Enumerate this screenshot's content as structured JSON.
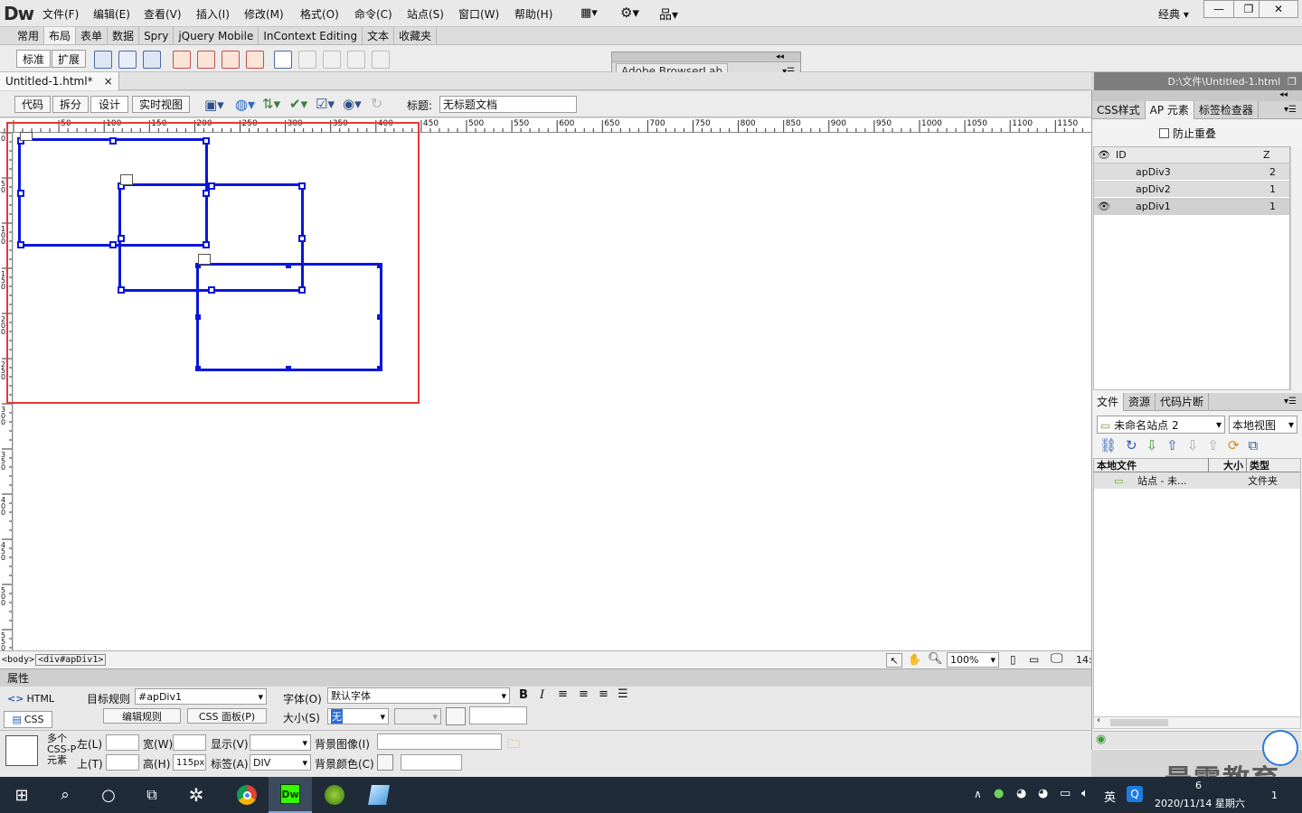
{
  "app": {
    "logo": "Dw",
    "workspace": "经典",
    "win_min": "—",
    "win_max": "❐",
    "win_close": "✕"
  },
  "menu": [
    "文件(F)",
    "编辑(E)",
    "查看(V)",
    "插入(I)",
    "修改(M)",
    "格式(O)",
    "命令(C)",
    "站点(S)",
    "窗口(W)",
    "帮助(H)"
  ],
  "insert_tabs": [
    "常用",
    "布局",
    "表单",
    "数据",
    "Spry",
    "jQuery Mobile",
    "InContext Editing",
    "文本",
    "收藏夹"
  ],
  "insert_active": "布局",
  "layout_modes": [
    "标准",
    "扩展"
  ],
  "browserlab": {
    "title": "Adobe BrowserLab"
  },
  "document": {
    "tab": "Untitled-1.html*",
    "close": "×",
    "path": "D:\\文件\\Untitled-1.html"
  },
  "doc_toolbar": {
    "views": [
      "代码",
      "拆分",
      "设计",
      "实时视图"
    ],
    "title_label": "标题:",
    "title_value": "无标题文档"
  },
  "ruler": {
    "h_ticks": [
      "50",
      "100",
      "150",
      "200",
      "250",
      "300",
      "350",
      "400",
      "450",
      "500",
      "550",
      "600",
      "650",
      "700",
      "750",
      "800",
      "850",
      "900",
      "950",
      "1000",
      "1050",
      "1100",
      "1150"
    ],
    "v_ticks": [
      "0",
      "5 0",
      "1 0 0",
      "1 5 0",
      "2 0 0",
      "2 5 0",
      "3 0 0",
      "3 5 0",
      "4 0 0",
      "4 5 0",
      "5 0 0",
      "5 5 0"
    ]
  },
  "tag_selector": [
    "<body>",
    "<div#apDiv1>"
  ],
  "status": {
    "zoom": "100%",
    "size": "14:"
  },
  "properties": {
    "header": "属性",
    "html_btn": "HTML",
    "css_btn": "CSS",
    "target_rule_label": "目标规则",
    "target_rule_value": "#apDiv1",
    "edit_rule": "编辑规则",
    "css_panel": "CSS 面板(P)",
    "font_label": "字体(O)",
    "font_value": "默认字体",
    "size_label": "大小(S)",
    "size_value": "无",
    "bold": "B",
    "italic": "I",
    "multi_label": [
      "多个",
      "CSS-P",
      "元素"
    ],
    "left_label": "左(L)",
    "top_label": "上(T)",
    "width_label": "宽(W)",
    "height_label": "高(H)",
    "height_value": "115px",
    "vis_label": "显示(V)",
    "tag_label": "标签(A)",
    "tag_value": "DIV",
    "bg_image_label": "背景图像(I)",
    "bg_color_label": "背景颜色(C)"
  },
  "ap_panel": {
    "tabs": [
      "CSS样式",
      "AP 元素",
      "标签检查器"
    ],
    "active": "AP 元素",
    "prevent_overlap": "防止重叠",
    "columns": {
      "id": "ID",
      "z": "Z"
    },
    "rows": [
      {
        "id": "apDiv3",
        "z": "2",
        "eye": false
      },
      {
        "id": "apDiv2",
        "z": "1",
        "eye": false
      },
      {
        "id": "apDiv1",
        "z": "1",
        "eye": true
      }
    ]
  },
  "files_panel": {
    "tabs": [
      "文件",
      "资源",
      "代码片断"
    ],
    "site": "未命名站点 2",
    "view": "本地视图",
    "columns": [
      "本地文件",
      "大小",
      "类型"
    ],
    "rows": [
      {
        "name": "站点 - 未...",
        "type": "文件夹"
      }
    ]
  },
  "taskbar": {
    "ime": "英",
    "time": "6",
    "date": "2020/11/14 星期六",
    "notif": "1"
  },
  "watermark": "最需教育",
  "colors": {
    "ap_border": "#0a16d9",
    "highlight": "#e53935",
    "taskbar": "#1f2b38"
  }
}
